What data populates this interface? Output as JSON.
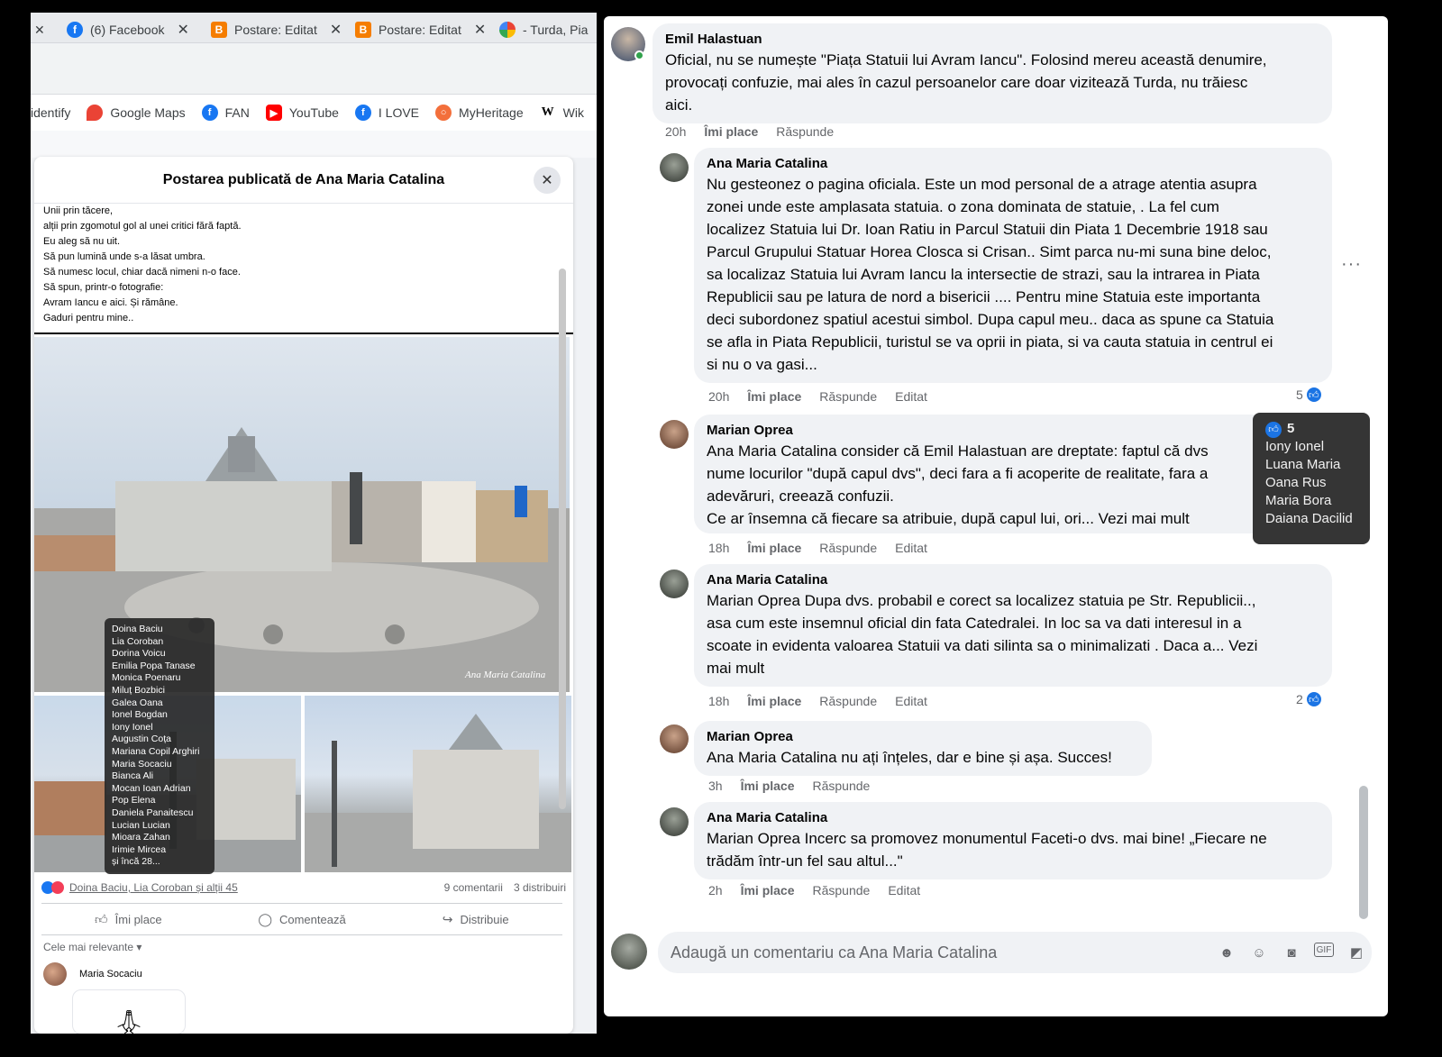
{
  "left_window": {
    "tabs": [
      {
        "label": "(6) Facebook",
        "icon": "facebook-icon"
      },
      {
        "label": "Postare: Editat",
        "icon": "blogger-icon"
      },
      {
        "label": "Postare: Editat",
        "icon": "blogger-icon"
      },
      {
        "label": "- Turda, Pia",
        "icon": "photos-icon"
      }
    ],
    "bookmarks": [
      {
        "label": "identify",
        "icon": ""
      },
      {
        "label": "Google Maps",
        "icon": "maps-pin-icon"
      },
      {
        "label": "FAN",
        "icon": "facebook-icon"
      },
      {
        "label": "YouTube",
        "icon": "youtube-icon"
      },
      {
        "label": "I LOVE",
        "icon": "facebook-icon"
      },
      {
        "label": "MyHeritage",
        "icon": "myheritage-icon"
      },
      {
        "label": "Wik",
        "icon": "wikipedia-icon"
      }
    ],
    "post": {
      "title": "Postarea publicată de Ana Maria Catalina",
      "lines": [
        "Unii prin tăcere,",
        "alții prin zgomotul gol al unei critici fără faptă.",
        "Eu aleg să nu uit.",
        "Să pun lumină unde s-a lăsat umbra.",
        "Să numesc locul, chiar dacă nimeni n-o face.",
        "Să spun, printr-o fotografie:",
        "Avram Iancu e aici. Și rămâne.",
        "Gaduri pentru mine.."
      ],
      "watermark": "Ana Maria Catalina",
      "likers": [
        "Doina Baciu",
        "Lia Coroban",
        "Dorina Voicu",
        "Emilia Popa Tanase",
        "Monica Poenaru",
        "Miluț Bozbici",
        "Galea Oana",
        "Ionel Bogdan",
        "Iony Ionel",
        "Augustin Coța",
        "Mariana Copil Arghiri",
        "Maria Socaciu",
        "Bianca Ali",
        "Mocan Ioan Adrian",
        "Pop Elena",
        "Daniela Panaitescu",
        "Lucian Lucian",
        "Mioara Zahan",
        "Irimie Mircea",
        "și încă 28..."
      ],
      "reactions_text": "Doina Baciu, Lia Coroban și alții 45",
      "comments_count": "9 comentarii",
      "shares_count": "3 distribuiri",
      "like_label": "Îmi place",
      "comment_label": "Comentează",
      "share_label": "Distribuie",
      "sort_label": "Cele mai relevante",
      "first_commenter": "Maria Socaciu"
    }
  },
  "comments": [
    {
      "name": "Emil Halastuan",
      "lines": [
        "Oficial, nu se numește \"Piața Statuii lui Avram Iancu\". Folosind mereu această denumire,",
        "provocați confuzie, mai ales în cazul persoanelor care doar vizitează Turda, nu trăiesc",
        "aici."
      ],
      "time": "20h",
      "like": "Îmi place",
      "reply": "Răspunde",
      "edited": ""
    },
    {
      "name": "Ana Maria Catalina",
      "lines": [
        "Nu gesteonez o pagina oficiala. Este un mod personal de a atrage atentia asupra",
        "zonei unde este amplasata statuia. o zona dominata de statuie, . La fel cum",
        "localizez Statuia lui Dr. Ioan Ratiu in Parcul Statuii din Piata 1 Decembrie 1918 sau",
        "Parcul Grupului Statuar Horea Closca si Crisan.. Simt parca nu-mi suna bine deloc,",
        "sa localizaz Statuia lui Avram Iancu la intersectie de strazi, sau la intrarea in Piata",
        "Republicii sau pe latura de nord a bisericii .... Pentru mine Statuia este importanta",
        "deci subordonez spatiul acestui simbol. Dupa capul meu.. daca as spune ca Statuia",
        "se afla in Piata Republicii, turistul se va oprii in piata, si va cauta statuia in centrul ei",
        "si nu o va gasi..."
      ],
      "time": "20h",
      "like": "Îmi place",
      "reply": "Răspunde",
      "edited": "Editat",
      "likes": "5"
    },
    {
      "name": "Marian Oprea",
      "lines": [
        "Ana Maria Catalina consider că Emil Halastuan are dreptate: faptul că dvs",
        "nume locurilor \"după capul dvs\", deci fara a fi acoperite de realitate, fara a",
        "adevăruri, creează confuzii.",
        "Ce ar însemna că fiecare sa atribuie, după capul lui, ori... Vezi mai mult"
      ],
      "time": "18h",
      "like": "Îmi place",
      "reply": "Răspunde",
      "edited": "Editat"
    },
    {
      "name": "Ana Maria Catalina",
      "lines": [
        "Marian Oprea Dupa dvs. probabil e corect sa localizez statuia pe Str. Republicii..,",
        "asa cum este insemnul oficial din fata Catedralei. In loc sa va dati interesul in a",
        "scoate in evidenta valoarea Statuii va dati silinta sa o minimalizati . Daca a... Vezi",
        "mai mult"
      ],
      "time": "18h",
      "like": "Îmi place",
      "reply": "Răspunde",
      "edited": "Editat",
      "likes": "2"
    },
    {
      "name": "Marian Oprea",
      "lines": [
        "Ana Maria Catalina nu ați înțeles, dar e bine și așa. Succes!"
      ],
      "time": "3h",
      "like": "Îmi place",
      "reply": "Răspunde",
      "edited": ""
    },
    {
      "name": "Ana Maria Catalina",
      "lines": [
        "Marian Oprea Incerc sa promovez monumentul Faceti-o dvs. mai bine! „Fiecare ne",
        "trădăm într-un fel sau altul...\""
      ],
      "time": "2h",
      "like": "Îmi place",
      "reply": "Răspunde",
      "edited": "Editat"
    }
  ],
  "likes_tooltip": {
    "count": "5",
    "names": [
      "Iony Ionel",
      "Luana Maria",
      "Oana Rus",
      "Maria Bora",
      "Daiana Dacilid"
    ]
  },
  "composer": {
    "placeholder": "Adaugă un comentariu ca Ana Maria Catalina",
    "tools": [
      "avatar-sticker-icon",
      "emoji-icon",
      "camera-icon",
      "gif-icon",
      "sticker-icon"
    ]
  },
  "colors": {
    "facebook_blue": "#1877f2",
    "bubble_gray": "#f0f2f5",
    "meta_gray": "#65676b"
  }
}
